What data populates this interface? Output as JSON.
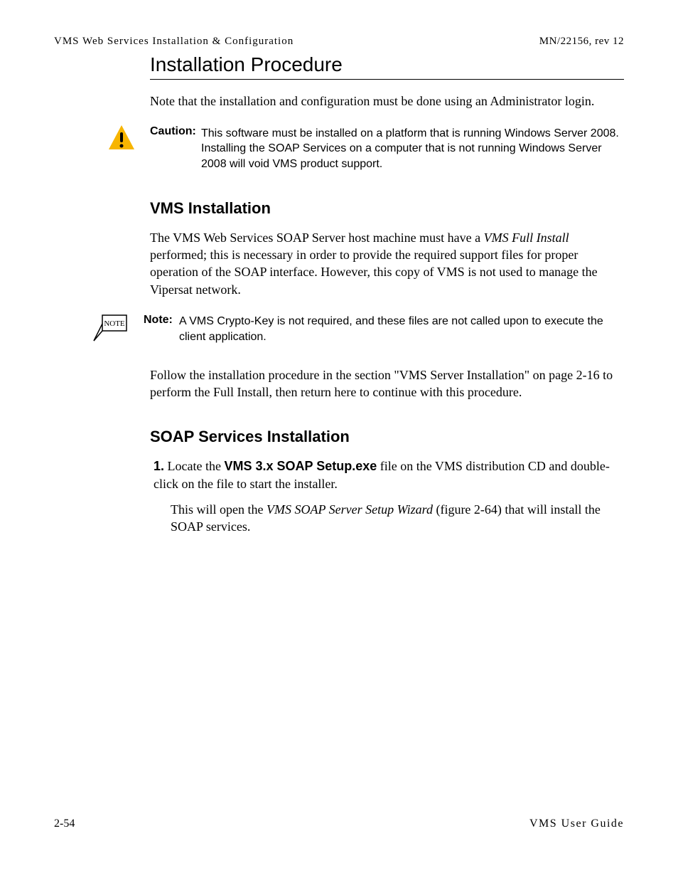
{
  "header": {
    "left": "VMS Web Services Installation & Configuration",
    "right": "MN/22156, rev 12"
  },
  "title": "Installation Procedure",
  "intro": "Note that the installation and configuration must be done using an Administrator login.",
  "caution": {
    "label": "Caution:",
    "text": "This software must be installed on a platform that is running Windows Server 2008. Installing the SOAP Services on a computer that is not running Windows Server 2008 will void VMS product support."
  },
  "vms": {
    "heading": "VMS Installation",
    "para1_prefix": "The VMS Web Services SOAP Server host machine must have a ",
    "para1_italic": "VMS Full Install",
    "para1_suffix": " performed; this is necessary in order to provide the required support files for proper operation of the SOAP interface. However, this copy of VMS is not used to manage the Vipersat network.",
    "note": {
      "label": "Note:",
      "text": "A VMS Crypto-Key is not required, and these files are not called upon to execute the client application."
    },
    "para2": "Follow the installation procedure in the section \"VMS Server Installation\" on page 2-16 to perform the Full Install, then return here to continue with this procedure."
  },
  "soap": {
    "heading": "SOAP Services Installation",
    "step1_num": " 1.",
    "step1_prefix": " Locate the ",
    "step1_bold": "VMS 3.x SOAP Setup.exe",
    "step1_suffix": " file on the VMS distribution CD and double-click on the file to start the installer.",
    "step1_follow_prefix": "This will open the ",
    "step1_follow_italic": "VMS SOAP Server Setup Wizard",
    "step1_follow_suffix": " (figure 2-64) that will install the SOAP services."
  },
  "footer": {
    "left": "2-54",
    "right": "VMS User Guide"
  },
  "note_badge": "NOTE"
}
